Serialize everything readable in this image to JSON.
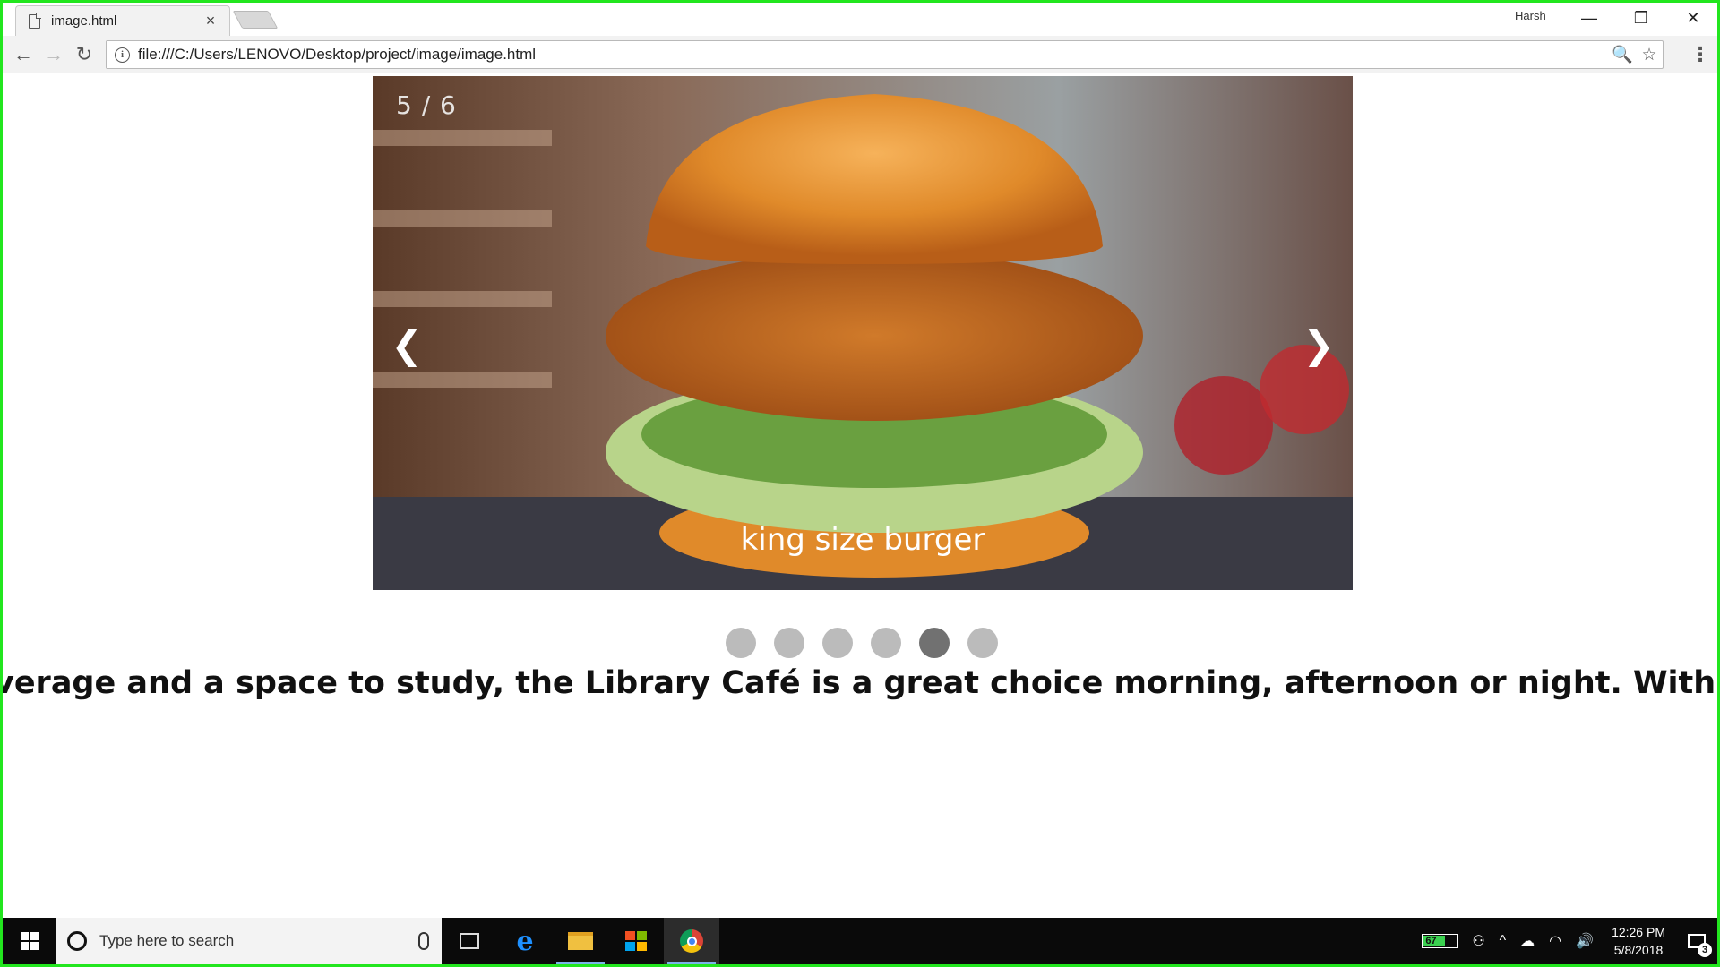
{
  "browser": {
    "tab_title": "image.html",
    "tab_close": "×",
    "profile_name": "Harsh",
    "url": "file:///C:/Users/LENOVO/Desktop/project/image/image.html",
    "window_controls": {
      "minimize": "—",
      "restore": "❐",
      "close": "✕"
    },
    "nav": {
      "back": "←",
      "forward": "→",
      "reload": "↻",
      "zoom": "🔍",
      "bookmark": "☆",
      "menu": "⋮"
    },
    "info_icon": "i"
  },
  "slideshow": {
    "counter": "5 / 6",
    "caption": "king size burger",
    "prev_arrow": "❮",
    "next_arrow": "❯",
    "total_slides": 6,
    "active_slide": 5
  },
  "dots": [
    {
      "active": false
    },
    {
      "active": false
    },
    {
      "active": false
    },
    {
      "active": false
    },
    {
      "active": true
    },
    {
      "active": false
    }
  ],
  "marquee": {
    "text": "verage and a space to study, the Library Café is a great choice morning, afternoon or night. With"
  },
  "taskbar": {
    "search_placeholder": "Type here to search",
    "battery_percent": "67",
    "time": "12:26 PM",
    "date": "5/8/2018",
    "notification_count": "3"
  },
  "colors": {
    "frame_border": "#22e61e",
    "dot_inactive": "#bbbbbb",
    "dot_active": "#717171",
    "taskbar_bg": "#0a0a0a"
  }
}
